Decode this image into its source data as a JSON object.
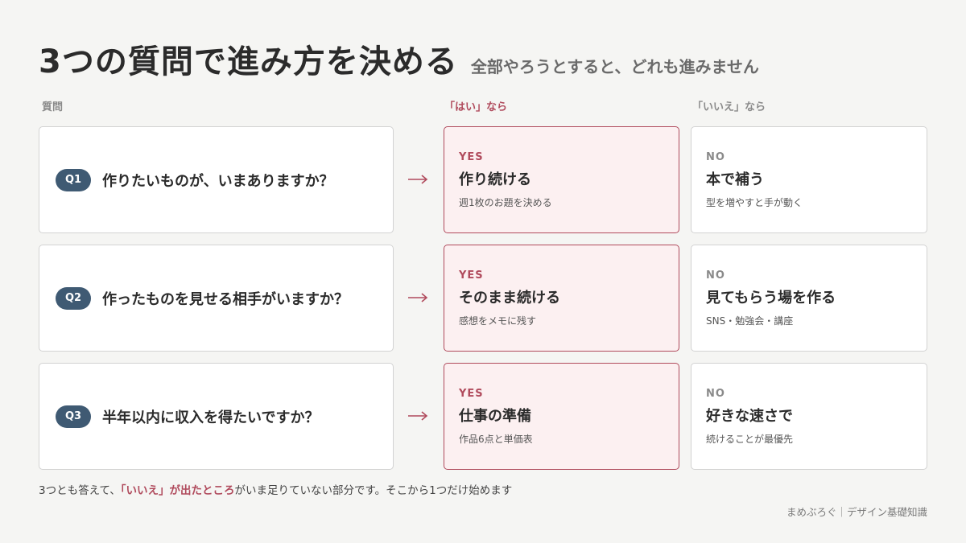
{
  "title": "3つの質問で進み方を決める",
  "subtitle": "全部やろうとすると、どれも進みません",
  "columns": {
    "question": "質問",
    "yes": "「はい」なら",
    "no": "「いいえ」なら"
  },
  "arrow_icon": "arrow-right-icon",
  "accent_color": "#b04a5c",
  "badge_color": "#3f5a73",
  "rows": [
    {
      "q_label": "Q1",
      "question": "作りたいものが、いまありますか？",
      "yes": {
        "tag": "YES",
        "head": "作り続ける",
        "desc": "週1枚のお題を決める"
      },
      "no": {
        "tag": "NO",
        "head": "本で補う",
        "desc": "型を増やすと手が動く"
      }
    },
    {
      "q_label": "Q2",
      "question": "作ったものを見せる相手がいますか？",
      "yes": {
        "tag": "YES",
        "head": "そのまま続ける",
        "desc": "感想をメモに残す"
      },
      "no": {
        "tag": "NO",
        "head": "見てもらう場を作る",
        "desc": "SNS・勉強会・講座"
      }
    },
    {
      "q_label": "Q3",
      "question": "半年以内に収入を得たいですか？",
      "yes": {
        "tag": "YES",
        "head": "仕事の準備",
        "desc": "作品6点と単価表"
      },
      "no": {
        "tag": "NO",
        "head": "好きな速さで",
        "desc": "続けることが最優先"
      }
    }
  ],
  "footnote": {
    "before": "3つとも答えて、",
    "highlight": "「いいえ」が出たところ",
    "after": "がいま足りていない部分です。そこから1つだけ始めます"
  },
  "credit": "まめぶろぐ｜デザイン基礎知識"
}
